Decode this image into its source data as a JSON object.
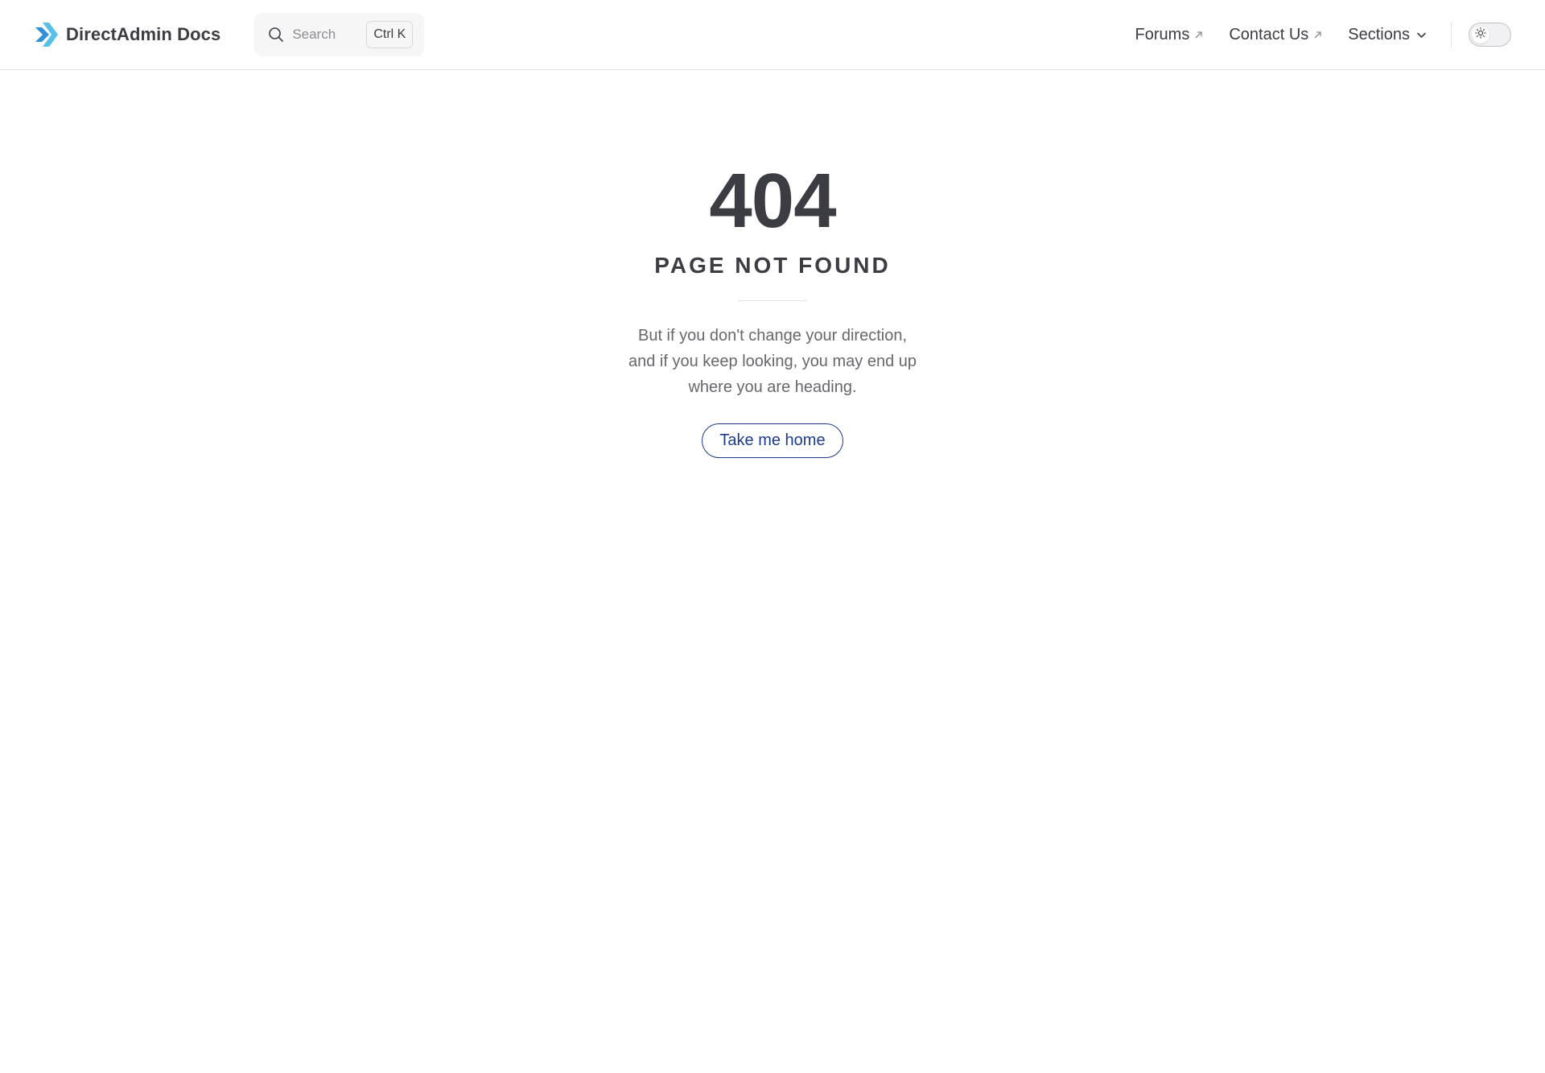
{
  "header": {
    "brand_title": "DirectAdmin Docs",
    "logo_icon": "directadmin-chevron-logo",
    "brand_colors": [
      "#2f8fd8",
      "#56c0e8"
    ],
    "search": {
      "placeholder": "Search",
      "shortcut": "Ctrl K",
      "icon": "search-icon"
    },
    "nav": {
      "forums_label": "Forums",
      "contact_label": "Contact Us",
      "sections_label": "Sections"
    },
    "theme_toggle": {
      "icon": "sun-icon",
      "state": "light"
    }
  },
  "main": {
    "code": "404",
    "title": "PAGE NOT FOUND",
    "quote": "But if you don't change your direction, and if you keep looking, you may end up where you are heading.",
    "home_button_label": "Take me home",
    "accent_color": "#1e3a8a"
  }
}
